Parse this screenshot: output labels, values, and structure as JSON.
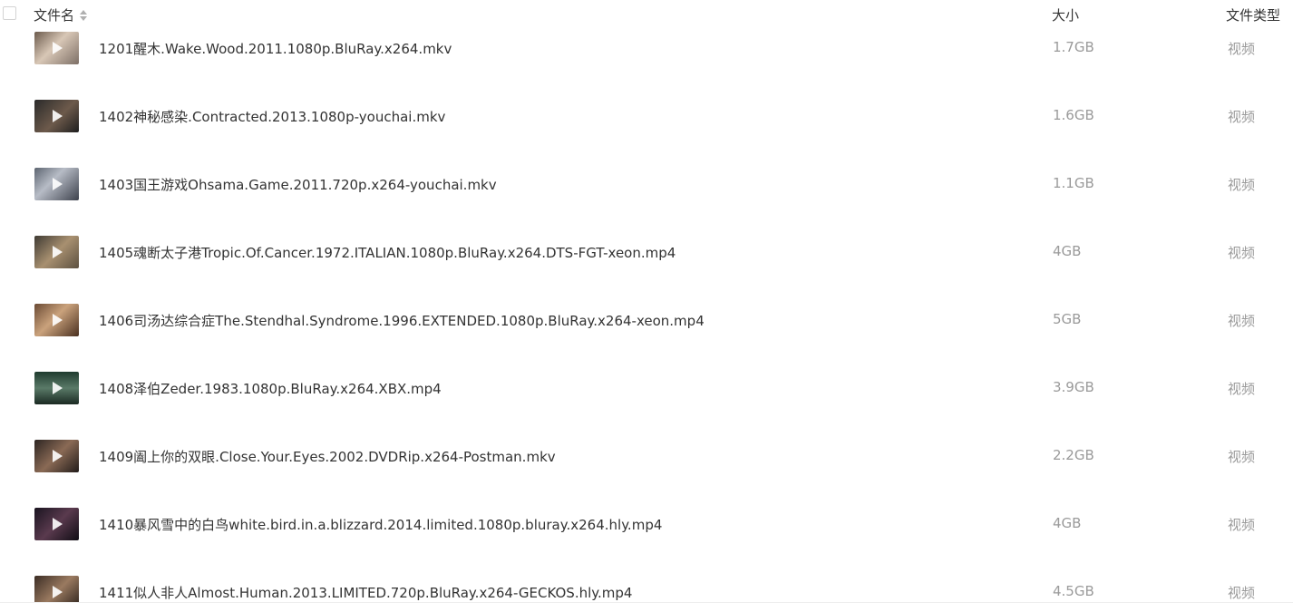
{
  "header": {
    "name_label": "文件名",
    "size_label": "大小",
    "type_label": "文件类型"
  },
  "colors": {
    "text": "#333333",
    "muted": "#9a9a9a"
  },
  "files": [
    {
      "name": "1201醒木.Wake.Wood.2011.1080p.BluRay.x264.mkv",
      "size": "1.7GB",
      "type": "视频",
      "thumb_icon": "video-thumbnail"
    },
    {
      "name": "1402神秘感染.Contracted.2013.1080p-youchai.mkv",
      "size": "1.6GB",
      "type": "视频",
      "thumb_icon": "video-thumbnail"
    },
    {
      "name": "1403国王游戏Ohsama.Game.2011.720p.x264-youchai.mkv",
      "size": "1.1GB",
      "type": "视频",
      "thumb_icon": "video-thumbnail"
    },
    {
      "name": "1405魂断太子港Tropic.Of.Cancer.1972.ITALIAN.1080p.BluRay.x264.DTS-FGT-xeon.mp4",
      "size": "4GB",
      "type": "视频",
      "thumb_icon": "video-thumbnail"
    },
    {
      "name": "1406司汤达综合症The.Stendhal.Syndrome.1996.EXTENDED.1080p.BluRay.x264-xeon.mp4",
      "size": "5GB",
      "type": "视频",
      "thumb_icon": "video-thumbnail"
    },
    {
      "name": "1408泽伯Zeder.1983.1080p.BluRay.x264.XBX.mp4",
      "size": "3.9GB",
      "type": "视频",
      "thumb_icon": "video-thumbnail"
    },
    {
      "name": "1409阖上你的双眼.Close.Your.Eyes.2002.DVDRip.x264-Postman.mkv",
      "size": "2.2GB",
      "type": "视频",
      "thumb_icon": "video-thumbnail"
    },
    {
      "name": "1410暴风雪中的白鸟white.bird.in.a.blizzard.2014.limited.1080p.bluray.x264.hly.mp4",
      "size": "4GB",
      "type": "视频",
      "thumb_icon": "video-thumbnail"
    },
    {
      "name": "1411似人非人Almost.Human.2013.LIMITED.720p.BluRay.x264-GECKOS.hly.mp4",
      "size": "4.5GB",
      "type": "视频",
      "thumb_icon": "video-thumbnail"
    }
  ]
}
